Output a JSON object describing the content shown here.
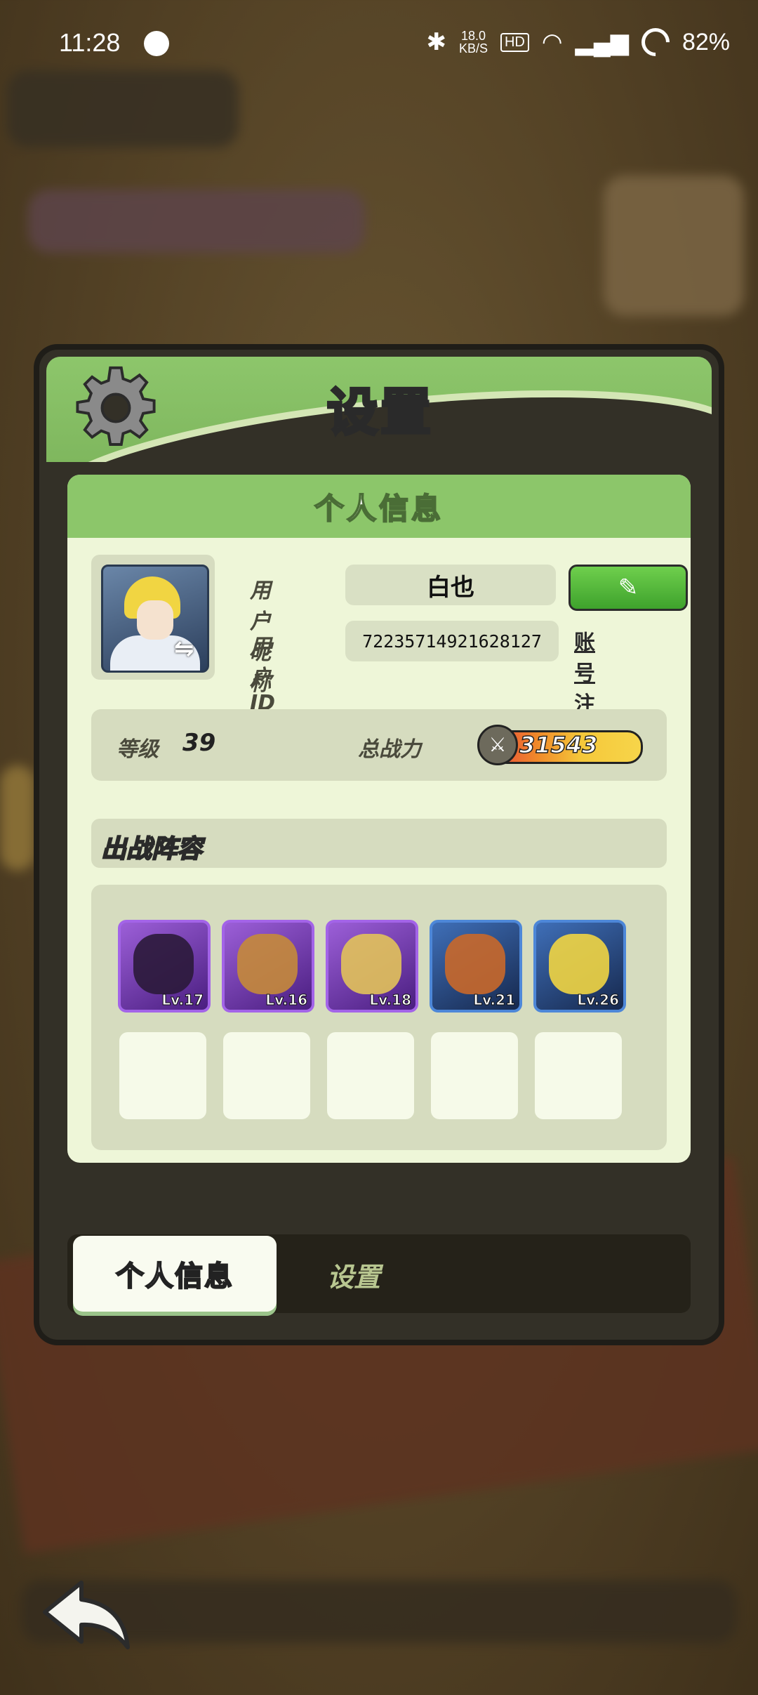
{
  "status_bar": {
    "time": "11:28",
    "net_speed_value": "18.0",
    "net_speed_unit": "KB/S",
    "hd_badge": "HD",
    "battery": "82%"
  },
  "modal": {
    "title": "设置",
    "panel_title": "个人信息",
    "nickname_label": "用户昵称",
    "nickname_value": "白也",
    "user_id_label": "用户 ID",
    "user_id_value": "72235714921628127",
    "cancel_account": "账号注销",
    "level_label": "等级",
    "level_value": "39",
    "power_label": "总战力",
    "power_value": "31543",
    "lineup_title": "出战阵容",
    "heroes": [
      {
        "level": "Lv.17",
        "frame": "purple"
      },
      {
        "level": "Lv.16",
        "frame": "purple"
      },
      {
        "level": "Lv.18",
        "frame": "purple"
      },
      {
        "level": "Lv.21",
        "frame": "blue"
      },
      {
        "level": "Lv.26",
        "frame": "blue"
      }
    ],
    "tabs": {
      "active": "个人信息",
      "inactive": "设置"
    }
  },
  "icons": [
    "gear-icon",
    "pencil-icon",
    "swap-icon",
    "sword-icon",
    "back-arrow-icon",
    "bluetooth-icon",
    "wifi-icon",
    "signal-icon"
  ]
}
